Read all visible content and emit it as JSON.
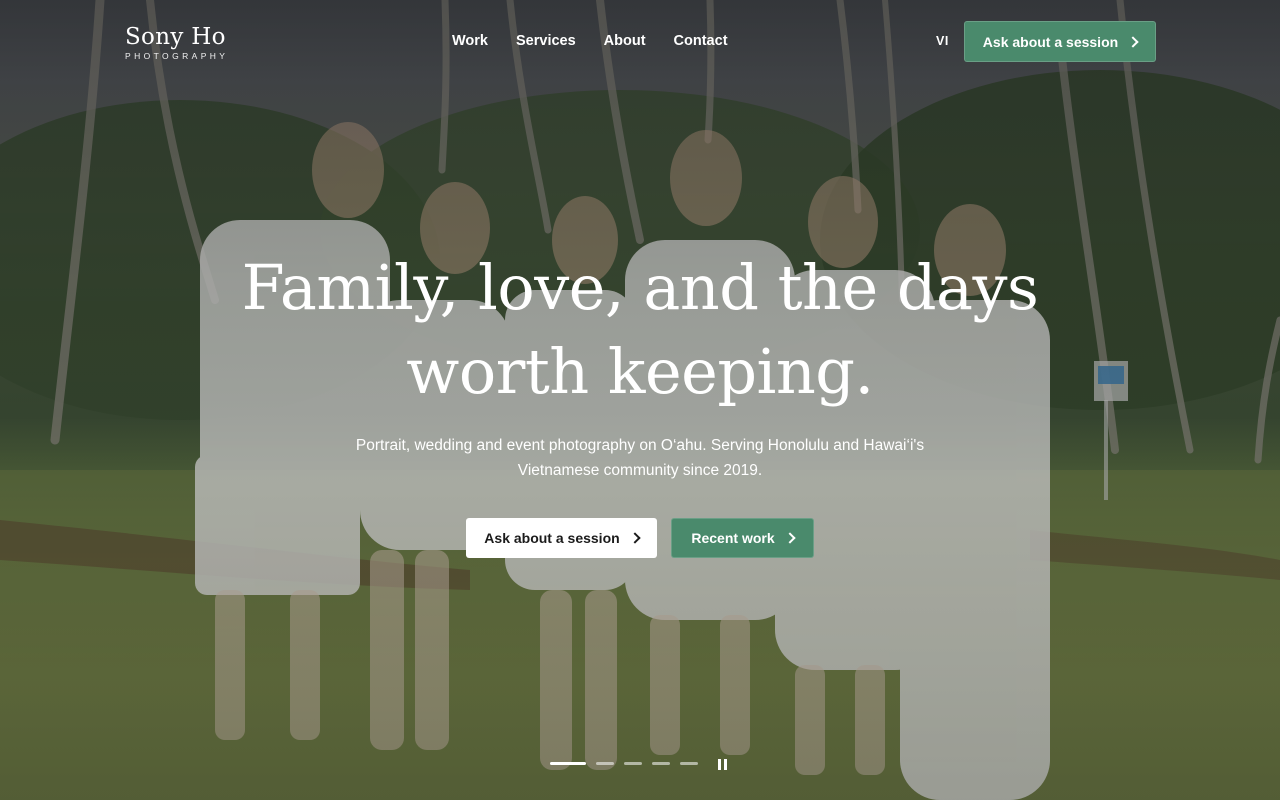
{
  "brand": {
    "name": "Sony Ho",
    "tagline": "PHOTOGRAPHY"
  },
  "nav": {
    "items": [
      {
        "label": "Work"
      },
      {
        "label": "Services"
      },
      {
        "label": "About"
      },
      {
        "label": "Contact"
      }
    ],
    "language_label": "VI",
    "cta_label": "Ask about a session"
  },
  "hero": {
    "headline_line1": "Family, love, and the days",
    "headline_line2": "worth keeping.",
    "subtext": "Portrait, wedding and event photography on O‘ahu. Serving Honolulu and Hawai‘i's Vietnamese community since 2019.",
    "primary_cta_label": "Ask about a session",
    "secondary_cta_label": "Recent work"
  },
  "carousel": {
    "slide_count": 5,
    "active_index": 0,
    "state": "playing",
    "control_icon": "pause-icon"
  },
  "colors": {
    "accent_green": "#4a8a6c",
    "text_light": "#ffffff",
    "button_light_bg": "#ffffff",
    "button_light_text": "#1b1b1b"
  },
  "icons": {
    "chevron": "chevron-right-icon",
    "pause": "pause-icon"
  }
}
